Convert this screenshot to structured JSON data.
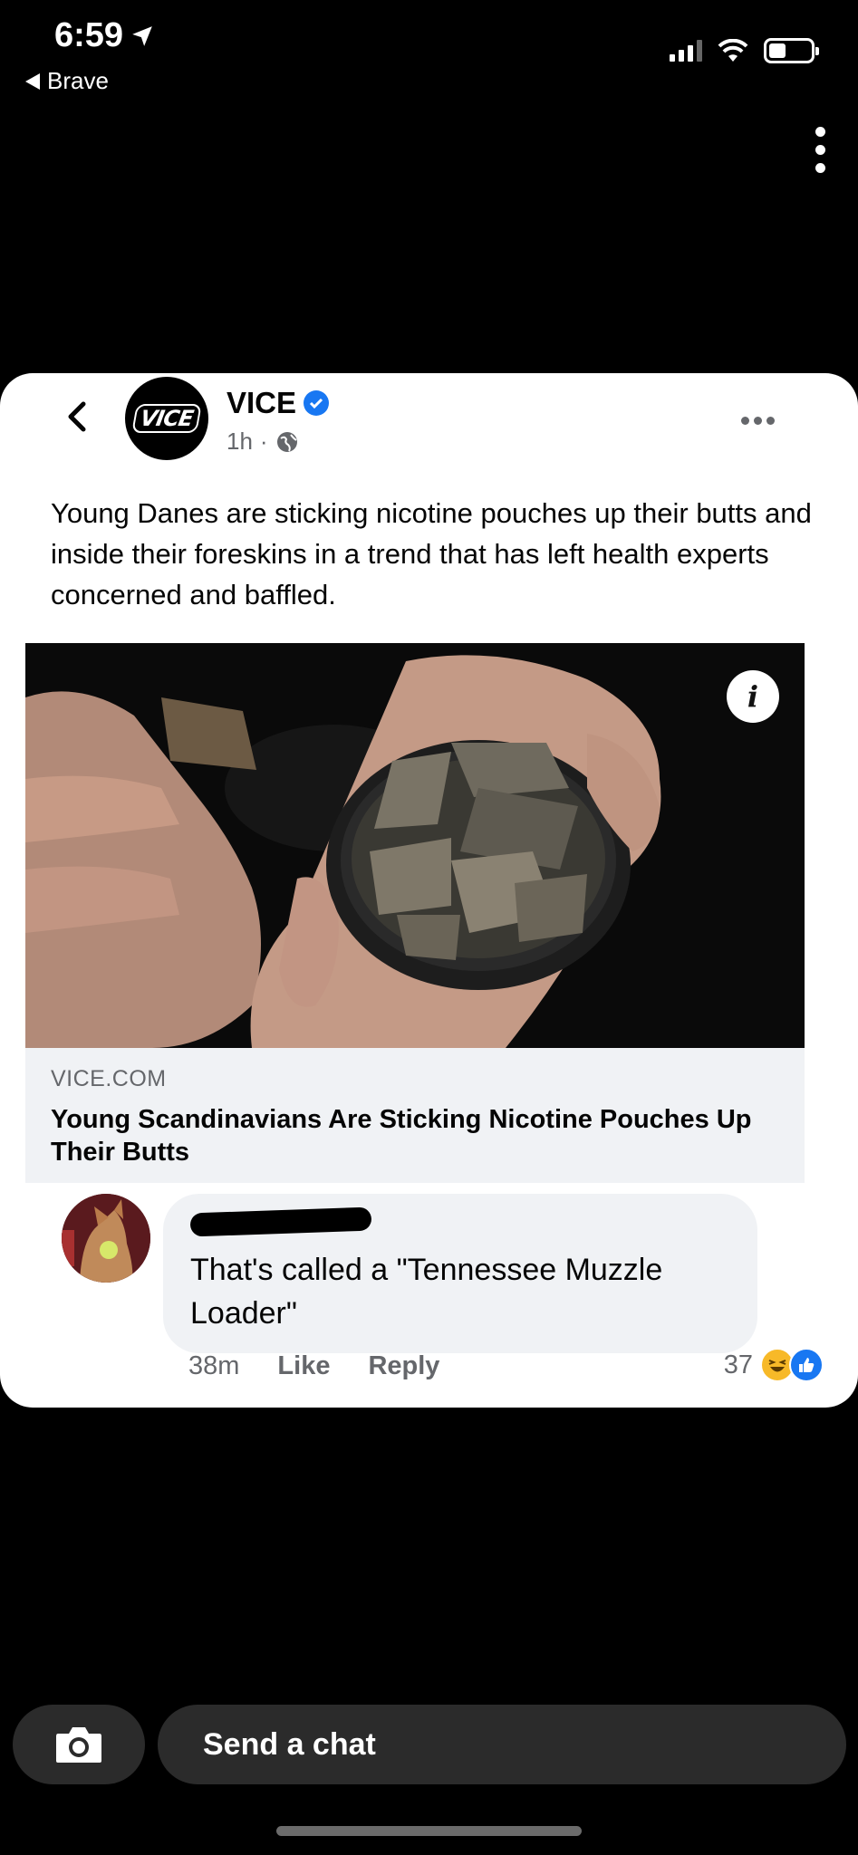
{
  "status_bar": {
    "time": "6:59",
    "back_app": "Brave"
  },
  "post": {
    "page_name": "VICE",
    "avatar_text": "VICE",
    "time_ago": "1h",
    "separator": "·",
    "text": "Young Danes are sticking nicotine pouches up their butts and inside their foreskins in a trend that has left health experts concerned and baffled.",
    "link": {
      "domain": "VICE.COM",
      "title": "Young Scandinavians Are Sticking Nicotine Pouches Up Their Butts",
      "info_glyph": "i"
    }
  },
  "comment": {
    "text": "That's called a \"Tennessee Muzzle Loader\"",
    "time_ago": "38m",
    "like_label": "Like",
    "reply_label": "Reply",
    "reaction_count": "37",
    "reactions": [
      "haha",
      "like"
    ]
  },
  "chat_bar": {
    "placeholder": "Send a chat"
  },
  "icons": {
    "location": "location-arrow-icon",
    "back": "chevron-left-icon",
    "verified": "verified-badge-icon",
    "globe": "globe-icon",
    "more": "more-horizontal-icon",
    "menu": "more-vertical-icon",
    "camera": "camera-icon"
  },
  "colors": {
    "facebook_blue": "#1877f2",
    "haha_yellow": "#f7b928",
    "bubble_gray": "#f0f2f5",
    "secondary_text": "#65676b"
  }
}
